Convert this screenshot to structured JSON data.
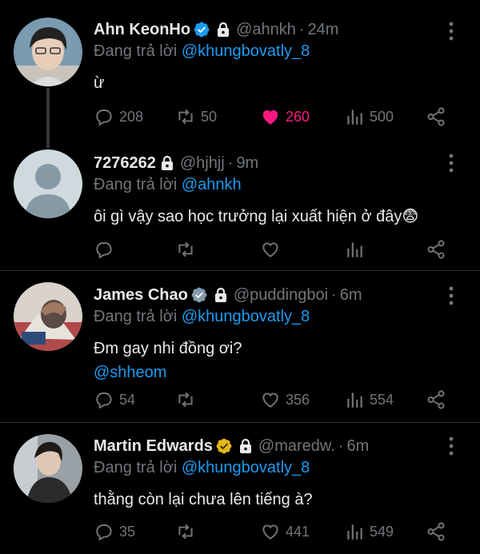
{
  "colors": {
    "accent": "#1d9bf0",
    "like": "#f91880",
    "muted": "#71767b",
    "verified_blue": "#1d9bf0",
    "verified_gold": "#e2b719"
  },
  "tweets": [
    {
      "name": "Ahn KeonHo",
      "verified": "blue",
      "handle": "@ahnkh",
      "time": "24m",
      "reply_prefix": "Đang trả lời",
      "reply_to": "@khungbovatly_8",
      "text": "ừ",
      "mention": "",
      "replies": "208",
      "retweets": "50",
      "likes": "260",
      "liked": true,
      "views": "500"
    },
    {
      "name": "7276262",
      "verified": "none",
      "handle": "@hjhjj",
      "time": "9m",
      "reply_prefix": "Đang trả lời",
      "reply_to": "@ahnkh",
      "text": "ôi gì vậy sao học trưởng lại xuất hiện ở đây😨",
      "mention": "",
      "replies": "",
      "retweets": "",
      "likes": "",
      "liked": false,
      "views": ""
    },
    {
      "name": "James Chao",
      "verified": "gray",
      "handle": "@puddingboi",
      "time": "6m",
      "reply_prefix": "Đang trả lời",
      "reply_to": "@khungbovatly_8",
      "text": "Đm gay nhi đồng ơi?",
      "mention": "@shheom",
      "replies": "54",
      "retweets": "",
      "likes": "356",
      "liked": false,
      "views": "554"
    },
    {
      "name": "Martin Edwards",
      "verified": "gold",
      "handle": "@maredw.",
      "time": "6m",
      "reply_prefix": "Đang trả lời",
      "reply_to": "@khungbovatly_8",
      "text": "thằng còn lại chưa lên tiếng à?",
      "mention": "",
      "replies": "35",
      "retweets": "",
      "likes": "441",
      "liked": false,
      "views": "549"
    }
  ]
}
